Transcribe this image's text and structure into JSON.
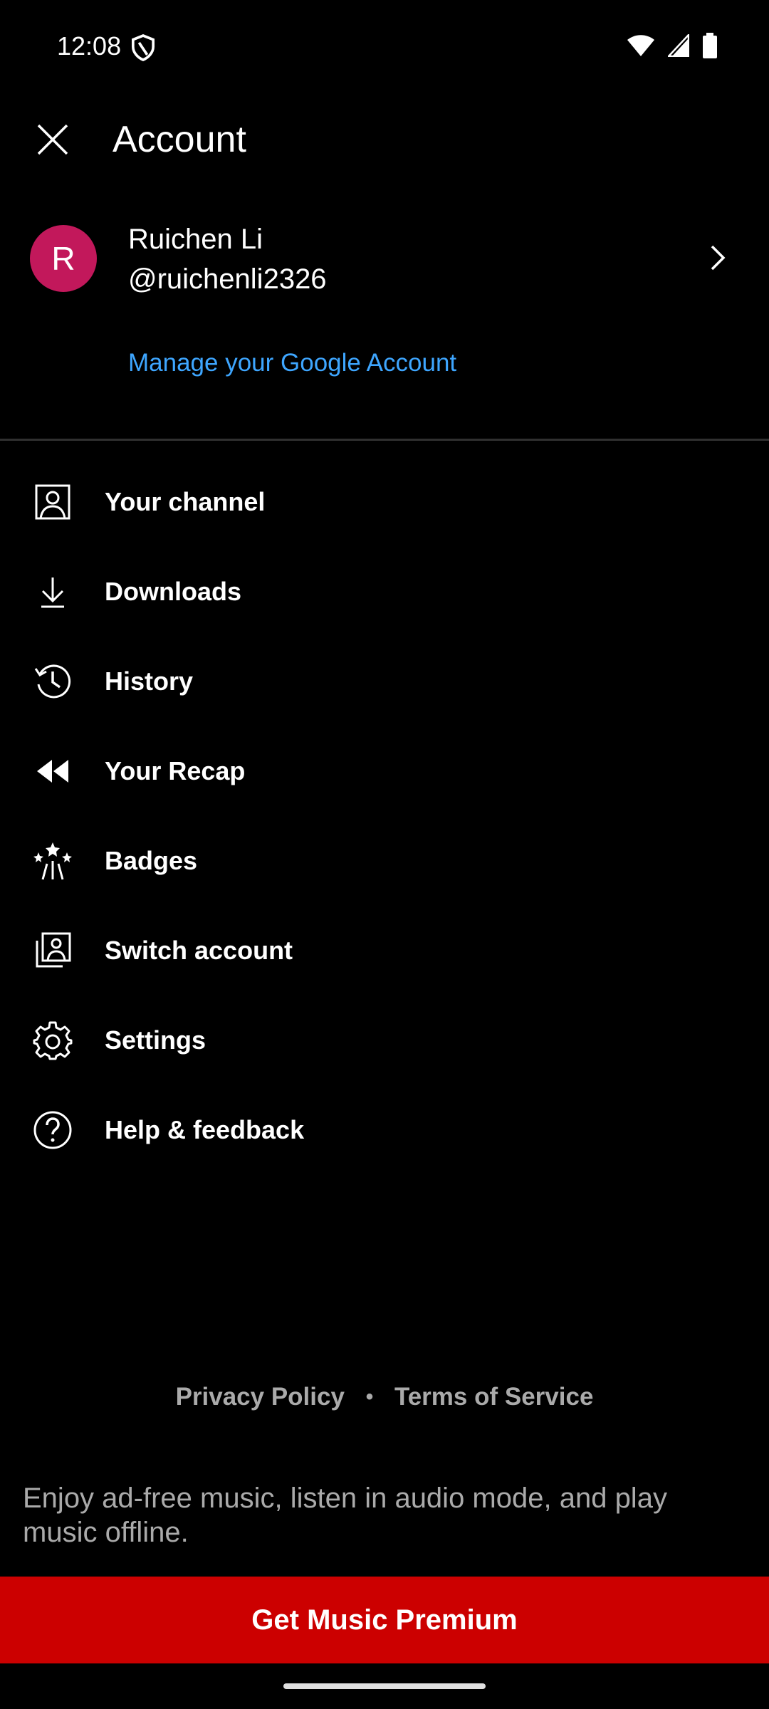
{
  "status_bar": {
    "time": "12:08",
    "icons": [
      "shield-icon",
      "wifi-icon",
      "signal-icon",
      "battery-icon"
    ]
  },
  "header": {
    "title": "Account",
    "close_icon": "close-icon"
  },
  "profile": {
    "avatar_letter": "R",
    "avatar_color": "#c2185b",
    "name": "Ruichen Li",
    "handle": "@ruichenli2326",
    "manage_link": "Manage your Google Account"
  },
  "menu": {
    "items": [
      {
        "label": "Your channel",
        "icon": "person-icon"
      },
      {
        "label": "Downloads",
        "icon": "download-icon"
      },
      {
        "label": "History",
        "icon": "history-icon"
      },
      {
        "label": "Your Recap",
        "icon": "rewind-icon"
      },
      {
        "label": "Badges",
        "icon": "badges-icon"
      },
      {
        "label": "Switch account",
        "icon": "switch-account-icon"
      },
      {
        "label": "Settings",
        "icon": "gear-icon"
      },
      {
        "label": "Help & feedback",
        "icon": "help-icon"
      }
    ]
  },
  "footer": {
    "privacy": "Privacy Policy",
    "separator": "•",
    "terms": "Terms of Service"
  },
  "promo": {
    "text": "Enjoy ad-free music, listen in audio mode, and play music offline.",
    "button_label": "Get Music Premium",
    "button_color": "#cc0000",
    "link_color": "#3ea6ff"
  }
}
